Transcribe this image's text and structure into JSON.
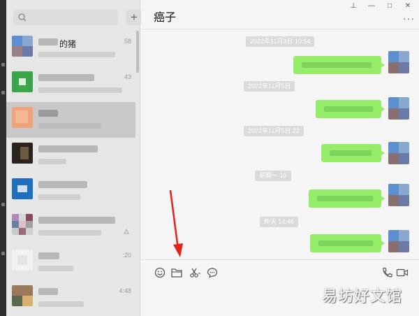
{
  "search": {
    "placeholder": "",
    "value": ""
  },
  "contacts": [
    {
      "name": "的猪",
      "time": "58",
      "selected": false
    },
    {
      "name": "",
      "time": "43",
      "selected": false
    },
    {
      "name": "",
      "time": "",
      "selected": true
    },
    {
      "name": "",
      "time": "",
      "selected": false
    },
    {
      "name": "",
      "time": "",
      "selected": false
    },
    {
      "name": "",
      "time": "",
      "selected": false
    },
    {
      "name": "",
      "time": ":20",
      "selected": false
    },
    {
      "name": "",
      "time": "4:48",
      "selected": false
    }
  ],
  "chat": {
    "title": "癌子",
    "timestamps": [
      "2022年11月3日 10:54",
      "2022年11月5日",
      "2022年11月5日 22",
      "星期一 16",
      "昨天 14:46"
    ]
  },
  "window_controls": {
    "pin": "⊥",
    "minimize": "—",
    "maximize": "□",
    "close": "✕"
  },
  "more_label": "···",
  "icons": [
    "search-icon",
    "plus-icon",
    "emoji-icon",
    "folder-icon",
    "scissors-icon",
    "chat-bubble-icon",
    "phone-icon",
    "video-icon"
  ],
  "watermark": "易坊好文馆",
  "colors": {
    "bubble": "#95ec69",
    "sidebar": "#e6e6e6",
    "chat_bg": "#f5f5f5",
    "arrow": "#e8201a"
  }
}
